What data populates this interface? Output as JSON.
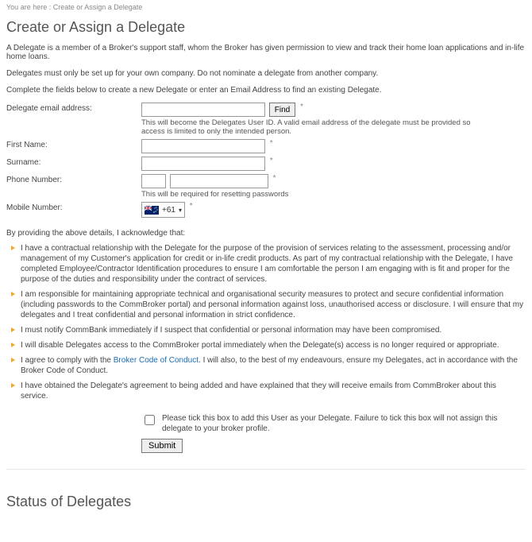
{
  "breadcrumb": "You are here : Create or Assign a Delegate",
  "heading": "Create or Assign a Delegate",
  "intro": {
    "p1": "A Delegate is a member of a Broker's support staff, whom the Broker has given permission to view and track their home loan applications and in-life home loans.",
    "p2": "Delegates must only be set up for your own company. Do not nominate a delegate from another company.",
    "p3": "Complete the fields below to create a new Delegate or enter an Email Address to find an existing Delegate."
  },
  "form": {
    "email_label": "Delegate email address:",
    "email_value": "",
    "find_label": "Find",
    "email_hint": "This will become the Delegates User ID. A valid email address of the delegate must be provided so access is limited to only the intended person.",
    "first_name_label": "First Name:",
    "first_name_value": "",
    "surname_label": "Surname:",
    "surname_value": "",
    "phone_label": "Phone Number:",
    "phone_area_value": "",
    "phone_number_value": "",
    "phone_hint": "This will be required for resetting passwords",
    "mobile_label": "Mobile Number:",
    "dial_code": "+61",
    "triangle": "▾",
    "required_mark": "*"
  },
  "ack_intro": "By providing the above details, I acknowledge that:",
  "ack": {
    "b1": "I have a contractual relationship with the Delegate for the purpose of the provision of services relating to the assessment, processing and/or management of my Customer's application for credit or in-life credit products. As part of my contractual relationship with the Delegate, I have completed Employee/Contractor Identification procedures to ensure I am comfortable the person I am engaging with is fit and proper for the purpose of the duties and responsibility under the contract of services.",
    "b2": "I am responsible for maintaining appropriate technical and organisational security measures to protect and secure confidential information (including passwords to the CommBroker portal) and personal information against loss, unauthorised access or disclosure. I will ensure that my delegates and I treat confidential and personal information in strict confidence.",
    "b3": "I must notify CommBank immediately if I suspect that confidential or personal information may have been compromised.",
    "b4": "I will disable Delegates access to the CommBroker portal immediately when the Delegate(s) access is no longer required or appropriate.",
    "b5_prefix": "I agree to comply with the ",
    "b5_link": "Broker Code of Conduct",
    "b5_suffix": ". I will also, to the best of my endeavours, ensure my Delegates, act in accordance with the Broker Code of Conduct.",
    "b6": "I have obtained the Delegate's agreement to being added and have explained that they will receive emails from CommBroker about this service."
  },
  "tick_label": "Please tick this box to add this User as your Delegate. Failure to tick this box will not assign this delegate to your broker profile.",
  "submit_label": "Submit",
  "status_heading": "Status of Delegates"
}
